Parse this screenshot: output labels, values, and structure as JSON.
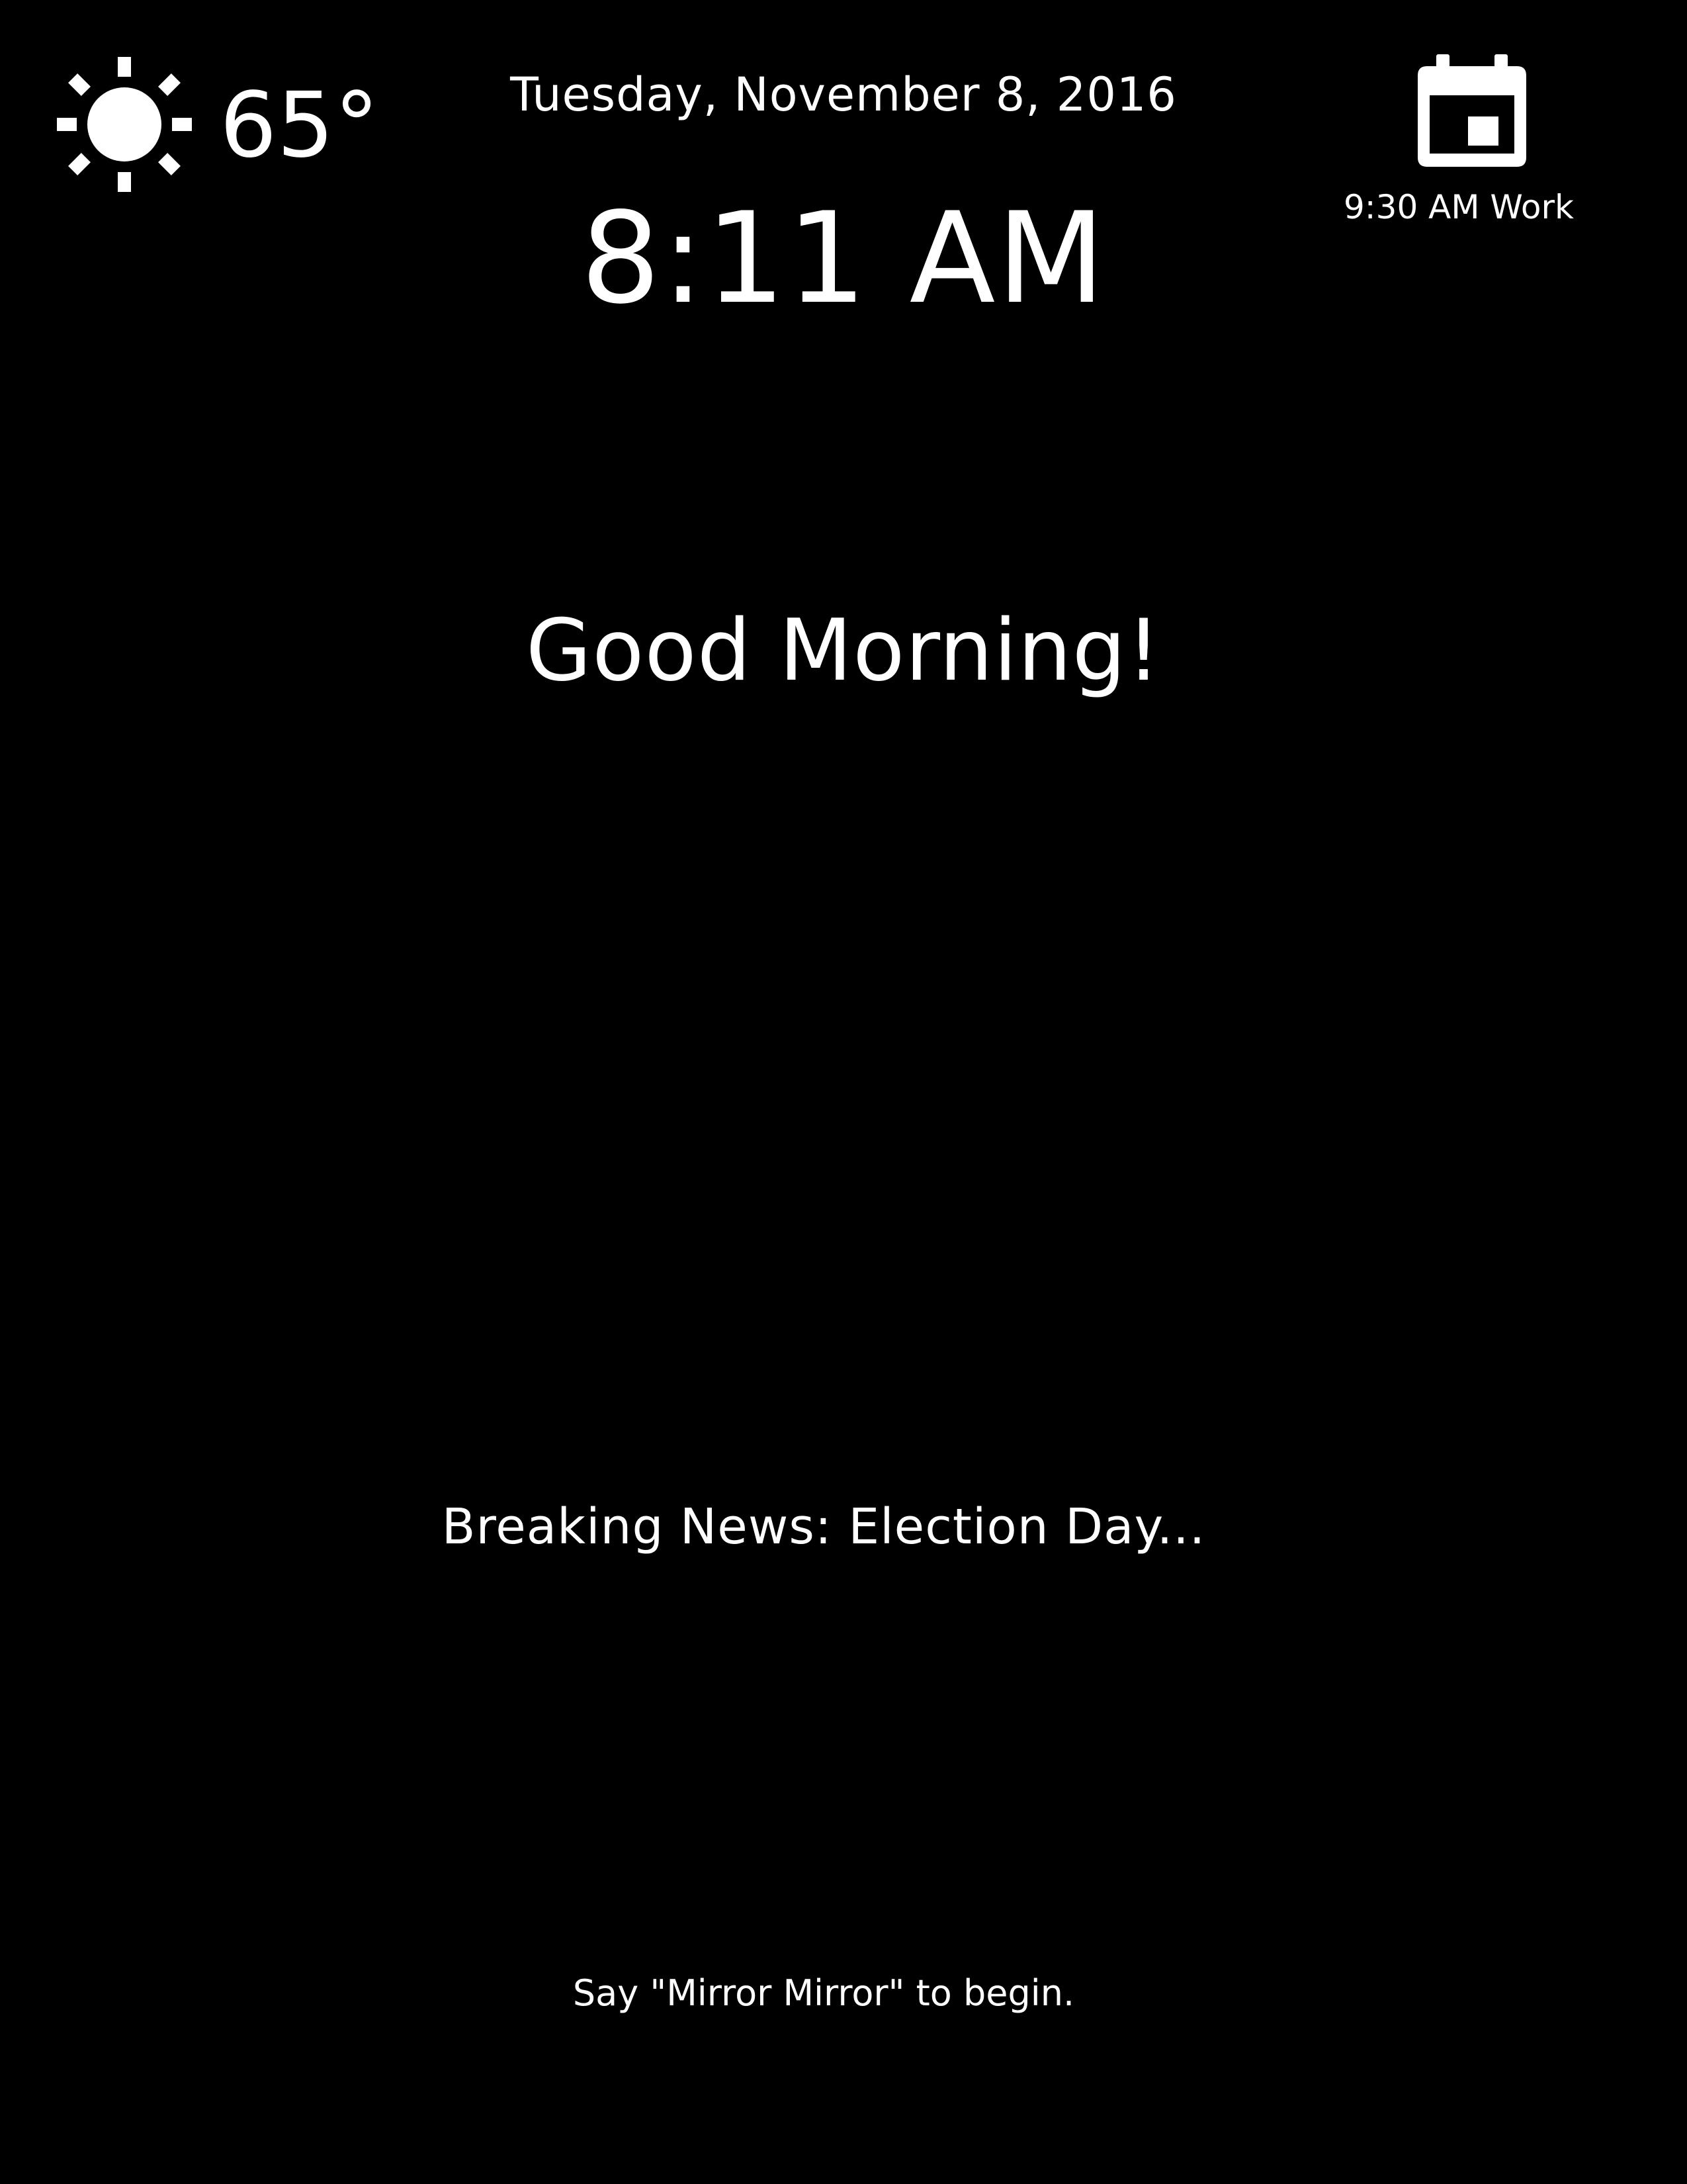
{
  "weather": {
    "icon": "sun-icon",
    "temperature": "65°"
  },
  "clock": {
    "date": "Tuesday, November 8, 2016",
    "time": "8:11 AM"
  },
  "calendar": {
    "icon": "calendar-icon",
    "next_event": "9:30 AM Work"
  },
  "greeting": "Good Morning!",
  "news": {
    "headline": "Breaking News: Election Day..."
  },
  "voice_prompt": "Say \"Mirror Mirror\" to begin.",
  "colors": {
    "background": "#000000",
    "foreground": "#ffffff"
  }
}
